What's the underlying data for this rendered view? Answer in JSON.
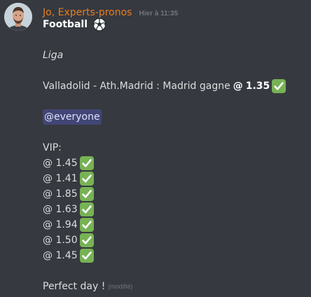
{
  "message": {
    "author": "Jo, Experts-pronos",
    "timestamp": "Hier à 11:35",
    "title": "Football",
    "title_icon": "soccer-ball-icon",
    "league": "Liga",
    "match": "Valladolid - Ath.Madrid : Madrid gagne",
    "match_odd_prefix": "@",
    "match_odd": "1.35",
    "mention": "@everyone",
    "vip_label": "VIP:",
    "vip_odds": [
      "@ 1.45",
      "@ 1.41",
      "@ 1.85",
      "@ 1.63",
      "@ 1.94",
      "@ 1.50",
      "@ 1.45"
    ],
    "closing": "Perfect day !",
    "edited_label": "(modifié)"
  },
  "colors": {
    "background": "#36393f",
    "username": "#e67e22",
    "check_green": "#77b255",
    "mention_bg": "#414675"
  }
}
